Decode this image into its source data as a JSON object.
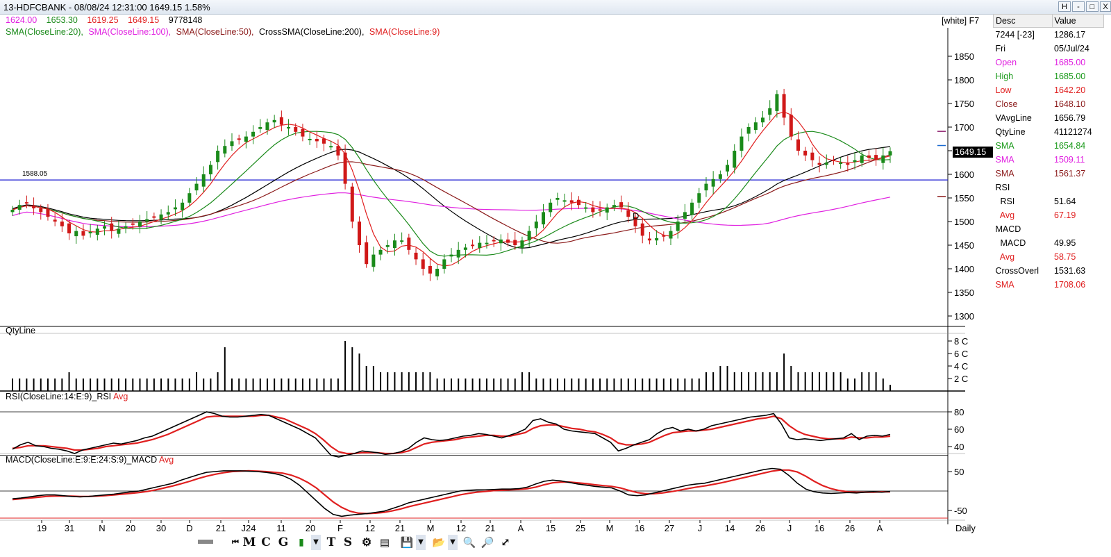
{
  "window": {
    "title": "13-HDFCBANK - 08/08/24 12:31:00 1649.15 1.58%",
    "buttons": [
      "H",
      "-",
      "□",
      "X"
    ]
  },
  "ohlc": {
    "open": "1624.00",
    "high": "1653.30",
    "low": "1619.25",
    "close": "1649.15",
    "volume": "9778148",
    "colors": {
      "open": "#e020e0",
      "high": "#1a8a1a",
      "low": "#e02020",
      "close": "#e02020"
    }
  },
  "indicators_legend": [
    {
      "text": "SMA(CloseLine:20),",
      "color": "#1a8a1a"
    },
    {
      "text": "SMA(CloseLine:100),",
      "color": "#e020e0"
    },
    {
      "text": "SMA(CloseLine:50),",
      "color": "#8b1a1a"
    },
    {
      "text": "CrossSMA(CloseLine:200),",
      "color": "#000000"
    },
    {
      "text": "SMA(CloseLine:9)",
      "color": "#e02020"
    }
  ],
  "scheme_label": "[white] F7",
  "reference_line_label": "1588.05",
  "last_price_tag": "1649.15",
  "price_axis": [
    "1850",
    "1800",
    "1750",
    "1700",
    "1650",
    "1600",
    "1550",
    "1500",
    "1450",
    "1400",
    "1350",
    "1300"
  ],
  "volume_panel": {
    "label": "QtyLine",
    "axis": [
      "8 C",
      "6 C",
      "4 C",
      "2 C"
    ]
  },
  "rsi_panel": {
    "label": "RSI(CloseLine:14:E:9)_RSI",
    "avg_label": "Avg",
    "axis": [
      "80",
      "60",
      "40"
    ]
  },
  "macd_panel": {
    "label": "MACD(CloseLine:E:9:E:24:S:9)_MACD",
    "avg_label": "Avg",
    "axis": [
      "50",
      "-50"
    ]
  },
  "x_axis": {
    "labels": [
      "19",
      "31",
      "N",
      "20",
      "30",
      "D",
      "21",
      "J24",
      "11",
      "20",
      "F",
      "12",
      "21",
      "M",
      "12",
      "21",
      "A",
      "15",
      "25",
      "M",
      "16",
      "27",
      "J",
      "14",
      "26",
      "J",
      "16",
      "26",
      "A"
    ],
    "period": "Daily"
  },
  "chart_marker": "D",
  "toolbar": {
    "items": [
      "M",
      "C",
      "G",
      "T",
      "S"
    ]
  },
  "data_window": {
    "header": {
      "desc": "Desc",
      "value": "Value"
    },
    "rows": [
      {
        "desc": "7244 [-23]",
        "value": "1286.17",
        "color": "#000000"
      },
      {
        "desc": "Fri",
        "value": "05/Jul/24",
        "color": "#000000"
      },
      {
        "desc": "Open",
        "value": "1685.00",
        "color": "#e020e0"
      },
      {
        "desc": "High",
        "value": "1685.00",
        "color": "#1a9a1a"
      },
      {
        "desc": "Low",
        "value": "1642.20",
        "color": "#e02020"
      },
      {
        "desc": "Close",
        "value": "1648.10",
        "color": "#8b1a1a"
      },
      {
        "desc": "VAvgLine",
        "value": "1656.79",
        "color": "#000000"
      },
      {
        "desc": "QtyLine",
        "value": "41121274",
        "color": "#000000"
      },
      {
        "desc": "SMA",
        "value": "1654.84",
        "color": "#1a9a1a"
      },
      {
        "desc": "SMA",
        "value": "1509.11",
        "color": "#e020e0"
      },
      {
        "desc": "SMA",
        "value": "1561.37",
        "color": "#8b1a1a"
      },
      {
        "desc": "RSI",
        "value": "",
        "color": "#000000"
      },
      {
        "desc": "  RSI",
        "value": "51.64",
        "color": "#000000"
      },
      {
        "desc": "  Avg",
        "value": "67.19",
        "color": "#e02020"
      },
      {
        "desc": "MACD",
        "value": "",
        "color": "#000000"
      },
      {
        "desc": "  MACD",
        "value": "49.95",
        "color": "#000000"
      },
      {
        "desc": "  Avg",
        "value": "58.75",
        "color": "#e02020"
      },
      {
        "desc": "CrossOverl",
        "value": "1531.63",
        "color": "#000000"
      },
      {
        "desc": "SMA",
        "value": "1708.06",
        "color": "#e02020"
      }
    ]
  },
  "chart_data": [
    {
      "type": "candlestick",
      "title": "13-HDFCBANK",
      "ylim": [
        1280,
        1880
      ],
      "reference_line": 1588.05,
      "close_series": [
        1525,
        1535,
        1540,
        1528,
        1520,
        1510,
        1500,
        1490,
        1475,
        1480,
        1470,
        1478,
        1485,
        1490,
        1480,
        1485,
        1490,
        1495,
        1500,
        1505,
        1510,
        1515,
        1520,
        1530,
        1540,
        1560,
        1580,
        1600,
        1620,
        1650,
        1660,
        1670,
        1675,
        1680,
        1690,
        1700,
        1710,
        1715,
        1705,
        1700,
        1690,
        1680,
        1675,
        1670,
        1665,
        1660,
        1640,
        1580,
        1500,
        1450,
        1410,
        1430,
        1440,
        1450,
        1460,
        1460,
        1440,
        1420,
        1400,
        1390,
        1400,
        1420,
        1430,
        1440,
        1445,
        1450,
        1455,
        1455,
        1460,
        1462,
        1455,
        1450,
        1460,
        1480,
        1500,
        1520,
        1540,
        1550,
        1545,
        1540,
        1535,
        1530,
        1520,
        1525,
        1530,
        1535,
        1530,
        1510,
        1490,
        1470,
        1460,
        1465,
        1470,
        1480,
        1500,
        1520,
        1540,
        1560,
        1580,
        1590,
        1600,
        1620,
        1650,
        1680,
        1700,
        1710,
        1720,
        1740,
        1770,
        1720,
        1680,
        1650,
        1640,
        1630,
        1620,
        1625,
        1630,
        1625,
        1620,
        1630,
        1640,
        1635,
        1630,
        1640,
        1649
      ]
    },
    {
      "type": "bar",
      "title": "QtyLine",
      "values_cr": [
        2,
        2,
        2,
        2,
        2,
        2,
        2,
        2,
        3,
        2,
        2,
        2,
        2,
        2,
        2,
        2,
        2,
        2,
        2,
        2,
        2,
        2,
        2,
        2,
        2,
        2,
        3,
        2,
        2,
        3,
        7,
        2,
        2,
        2,
        2,
        2,
        2,
        2,
        2,
        2,
        2,
        2,
        2,
        2,
        2,
        2,
        2,
        8,
        7,
        6,
        4,
        4,
        3,
        3,
        3,
        3,
        3,
        3,
        3,
        3,
        2,
        2,
        2,
        2,
        2,
        2,
        2,
        2,
        2,
        2,
        2,
        2,
        3,
        3,
        2,
        2,
        2,
        2,
        2,
        2,
        2,
        2,
        2,
        2,
        2,
        2,
        2,
        2,
        2,
        2,
        2,
        2,
        2,
        2,
        2,
        2,
        2,
        2,
        3,
        3,
        4,
        4,
        3,
        3,
        3,
        3,
        3,
        3,
        3,
        6,
        4,
        3,
        3,
        3,
        3,
        3,
        3,
        3,
        2,
        2,
        3,
        3,
        3,
        2,
        1
      ]
    },
    {
      "type": "line",
      "title": "RSI(CloseLine:14:E:9)_RSI",
      "ylim": [
        20,
        90
      ],
      "series": [
        {
          "name": "RSI",
          "values": [
            37,
            42,
            45,
            41,
            40,
            38,
            37,
            35,
            32,
            36,
            38,
            40,
            42,
            44,
            43,
            45,
            47,
            50,
            52,
            56,
            60,
            64,
            68,
            72,
            76,
            80,
            78,
            75,
            74,
            74,
            75,
            76,
            77,
            76,
            72,
            68,
            64,
            60,
            55,
            50,
            40,
            30,
            28,
            30,
            32,
            35,
            34,
            33,
            31,
            32,
            34,
            38,
            45,
            50,
            48,
            47,
            48,
            50,
            52,
            53,
            55,
            54,
            52,
            50,
            53,
            56,
            60,
            70,
            72,
            68,
            66,
            60,
            58,
            57,
            56,
            55,
            50,
            45,
            35,
            38,
            42,
            45,
            48,
            55,
            60,
            62,
            58,
            60,
            58,
            60,
            64,
            66,
            68,
            70,
            72,
            74,
            75,
            76,
            78,
            66,
            50,
            48,
            49,
            48,
            47,
            48,
            49,
            50,
            55,
            48,
            52,
            53,
            52,
            54
          ]
        },
        {
          "name": "Avg",
          "values": [
            38,
            39,
            41,
            41,
            41,
            40,
            39,
            38,
            36,
            36,
            37,
            38,
            40,
            41,
            42,
            43,
            44,
            46,
            48,
            51,
            54,
            58,
            62,
            66,
            70,
            74,
            75,
            75,
            75,
            75,
            75,
            75,
            76,
            76,
            74,
            72,
            68,
            64,
            60,
            55,
            48,
            40,
            34,
            32,
            32,
            33,
            33,
            33,
            32,
            32,
            33,
            35,
            39,
            43,
            45,
            46,
            47,
            48,
            50,
            51,
            52,
            53,
            53,
            52,
            52,
            54,
            56,
            61,
            64,
            65,
            65,
            63,
            61,
            60,
            58,
            57,
            54,
            50,
            44,
            42,
            42,
            43,
            45,
            49,
            53,
            56,
            57,
            58,
            58,
            59,
            60,
            62,
            64,
            66,
            68,
            70,
            72,
            73,
            75,
            72,
            64,
            58,
            54,
            52,
            50,
            49,
            49,
            49,
            51,
            50,
            50,
            51,
            51,
            52
          ]
        }
      ]
    },
    {
      "type": "line",
      "title": "MACD(CloseLine:E:9:E:24:S:9)_MACD",
      "ylim": [
        -70,
        70
      ],
      "series": [
        {
          "name": "MACD",
          "values": [
            -20,
            -18,
            -15,
            -12,
            -10,
            -10,
            -12,
            -14,
            -15,
            -14,
            -12,
            -10,
            -8,
            -5,
            -2,
            0,
            5,
            10,
            15,
            20,
            28,
            35,
            42,
            48,
            50,
            52,
            52,
            52,
            51,
            50,
            48,
            45,
            40,
            30,
            15,
            -5,
            -25,
            -45,
            -60,
            -65,
            -62,
            -60,
            -58,
            -55,
            -52,
            -45,
            -38,
            -30,
            -25,
            -20,
            -15,
            -10,
            -5,
            0,
            2,
            3,
            3,
            4,
            5,
            5,
            6,
            10,
            18,
            25,
            28,
            26,
            22,
            18,
            15,
            12,
            10,
            8,
            0,
            -10,
            -12,
            -10,
            -5,
            0,
            5,
            10,
            15,
            18,
            20,
            25,
            30,
            35,
            40,
            45,
            50,
            55,
            58,
            56,
            40,
            20,
            5,
            -2,
            -5,
            -6,
            -5,
            -4,
            -5,
            -3,
            -2,
            -3,
            -1
          ]
        },
        {
          "name": "Avg",
          "values": [
            -22,
            -20,
            -18,
            -16,
            -14,
            -13,
            -13,
            -13,
            -14,
            -14,
            -13,
            -12,
            -10,
            -8,
            -6,
            -4,
            -1,
            3,
            8,
            13,
            19,
            25,
            32,
            38,
            43,
            47,
            50,
            51,
            52,
            51,
            50,
            48,
            46,
            41,
            33,
            22,
            8,
            -10,
            -28,
            -42,
            -52,
            -57,
            -58,
            -57,
            -55,
            -51,
            -46,
            -40,
            -35,
            -30,
            -25,
            -20,
            -15,
            -10,
            -6,
            -3,
            -1,
            1,
            2,
            3,
            4,
            6,
            10,
            16,
            21,
            23,
            23,
            21,
            19,
            16,
            14,
            12,
            8,
            2,
            -4,
            -7,
            -7,
            -5,
            -2,
            2,
            6,
            10,
            13,
            17,
            21,
            26,
            31,
            36,
            41,
            46,
            51,
            54,
            54,
            49,
            38,
            25,
            14,
            6,
            1,
            -2,
            -3,
            -3,
            -3,
            -2,
            -2
          ]
        }
      ]
    }
  ]
}
